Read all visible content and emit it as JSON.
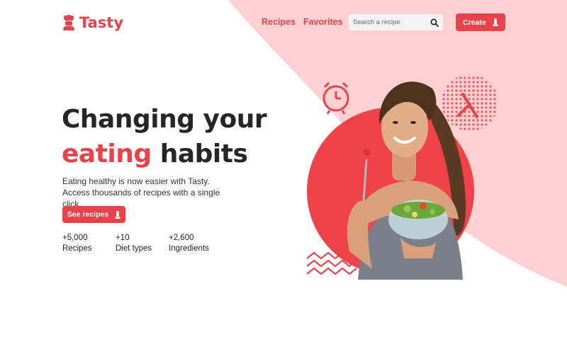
{
  "brand": {
    "name": "Tasty",
    "accent_color": "#e8434b",
    "logo_icon": "chef-icon"
  },
  "nav": {
    "links": [
      {
        "label": "Recipes"
      },
      {
        "label": "Favorites"
      }
    ]
  },
  "search": {
    "placeholder": "Search a recipe",
    "icon": "search-icon"
  },
  "header": {
    "create_label": "Create",
    "create_icon": "chef-icon"
  },
  "hero": {
    "title_line1": "Changing your",
    "title_line2_accent": "eating",
    "title_line2_rest": "habits",
    "description": "Eating healthy is now easier with Tasty. Access thousands of recipes with a single click.",
    "cta_label": "See recipes",
    "cta_icon": "chef-icon"
  },
  "stats": [
    {
      "value": "+5,000",
      "label": "Recipes"
    },
    {
      "value": "+10",
      "label": "Diet types"
    },
    {
      "value": "+2,600",
      "label": "Ingredients"
    }
  ],
  "visual": {
    "elements": [
      "alarm-clock-icon",
      "knife-icon",
      "woman-eating-salad",
      "zigzag-pattern",
      "dot-pattern"
    ]
  }
}
